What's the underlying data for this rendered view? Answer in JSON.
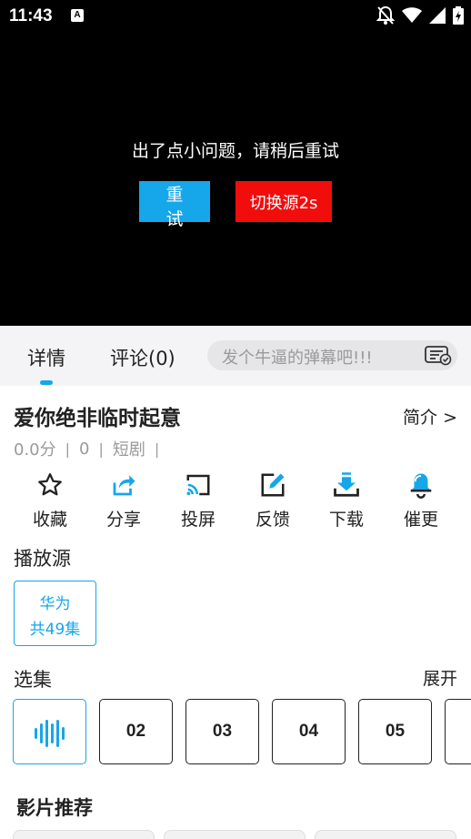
{
  "status_bar": {
    "time": "11:43",
    "a_badge": "A"
  },
  "player": {
    "error_message": "出了点小问题，请稍后重试",
    "retry_label": "重 试",
    "switch_label": "切换源2s"
  },
  "tabs": {
    "detail": "详情",
    "comment": "评论(0)"
  },
  "danmaku": {
    "placeholder": "发个牛逼的弹幕吧!!!"
  },
  "show": {
    "title": "爱你绝非临时起意",
    "intro_link": "简介 >",
    "score": "0.0分",
    "count": "0",
    "category": "短剧"
  },
  "actions": [
    {
      "label": "收藏",
      "icon": "star-icon"
    },
    {
      "label": "分享",
      "icon": "share-icon"
    },
    {
      "label": "投屏",
      "icon": "cast-icon"
    },
    {
      "label": "反馈",
      "icon": "edit-icon"
    },
    {
      "label": "下载",
      "icon": "download-icon"
    },
    {
      "label": "催更",
      "icon": "bell-icon"
    }
  ],
  "source": {
    "section_title": "播放源",
    "name": "华为",
    "episodes": "共49集"
  },
  "episodes": {
    "section_title": "选集",
    "expand": "展开",
    "items": [
      "02",
      "03",
      "04",
      "05"
    ]
  },
  "recommend": {
    "section_title": "影片推荐"
  },
  "colors": {
    "accent": "#16a6ea",
    "danger": "#f20d0d"
  }
}
